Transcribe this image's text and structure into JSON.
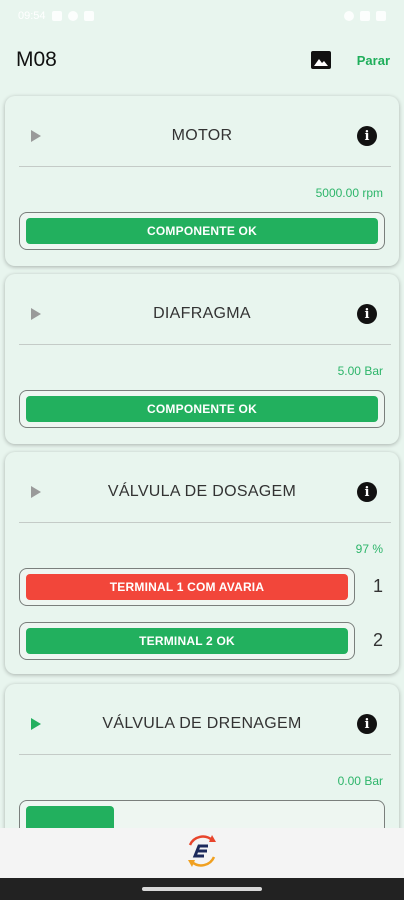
{
  "status_bar": {
    "time": "09:54"
  },
  "app_bar": {
    "title": "M08",
    "image_icon": "image-icon",
    "stop_label": "Parar"
  },
  "colors": {
    "accent": "#1fae5b",
    "ok": "#22b05e",
    "fault": "#f2463a",
    "background": "#e8f5ee"
  },
  "cards": [
    {
      "title": "MOTOR",
      "value": "5000.00 rpm",
      "status": {
        "label": "COMPONENTE OK",
        "state": "ok"
      }
    },
    {
      "title": "DIAFRAGMA",
      "value": "5.00 Bar",
      "status": {
        "label": "COMPONENTE OK",
        "state": "ok"
      }
    },
    {
      "title": "VÁLVULA DE DOSAGEM",
      "value": "97 %",
      "terminals": [
        {
          "label": "TERMINAL 1 COM AVARIA",
          "state": "fault",
          "number": "1"
        },
        {
          "label": "TERMINAL 2 OK",
          "state": "ok",
          "number": "2"
        }
      ]
    },
    {
      "title": "VÁLVULA DE DRENAGEM",
      "value": "0.00 Bar",
      "status": {
        "label": "",
        "state": "ok"
      }
    }
  ],
  "bottom_bar": {
    "logo_icon": "sync-logo-icon"
  }
}
